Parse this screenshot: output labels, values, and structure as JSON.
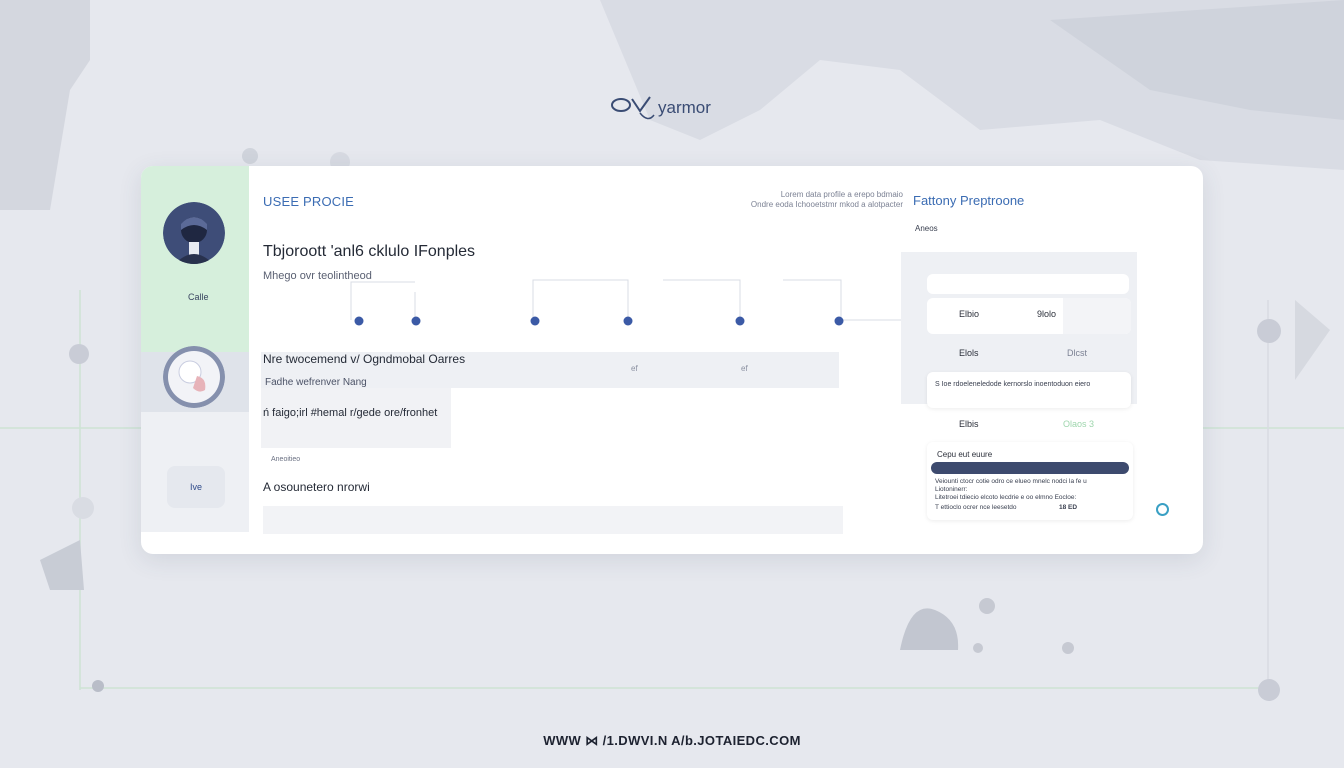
{
  "brand": {
    "logo_text": "yarmor"
  },
  "sidebar": {
    "items": [
      {
        "icon": "user-avatar-dark",
        "label": "Calle"
      },
      {
        "icon": "user-avatar-light",
        "label": ""
      },
      {
        "icon": "nav-tile",
        "label": "Ive"
      }
    ]
  },
  "main": {
    "section_title": "USEE PROCIE",
    "meta_lines": [
      "Lorem data profile  a   erepo bdmaio",
      "Ondre eoda Ichooetstmr mkod  a  alotpacter"
    ],
    "headline": "Tbjoroott 'anl6 cklulo IFonples",
    "subline": "Mhego ovr teolintheod",
    "timeline_points": 6,
    "row": {
      "title": "Nre twocemend v/ Ogndmobal Oarres",
      "subtitle": "Fadhe wefrenver Nang",
      "mini_a": "ef",
      "mini_b": "ef",
      "description": "ń faigo;irl #hemal   r/gede ore/fronhet"
    },
    "input": {
      "label": "Aneoitieo",
      "value": "A osounetero nrorwi"
    }
  },
  "right": {
    "title": "Fattony Preptroone",
    "subtitle": "Aneos",
    "kv_rows": [
      {
        "key": "Elbio",
        "value": "9lolo"
      },
      {
        "key": "Elols",
        "value": "Dlcst"
      },
      {
        "key": "Elbis",
        "value": "Olaos 3"
      }
    ],
    "note": "S  Ioe rdoeleneledode kernorslo inoentoduon eiero",
    "security": {
      "heading": "Cepu eut euure",
      "lines": [
        "Veiounti ctocr cotie odro ce elueo mnelc nodci la fe u",
        "Liotoninerr:",
        "Litetroei tdiecio elcoto lecdrie e oo elmno Eocloe:",
        "T ettioclo  ocrer nce   leesetdo"
      ],
      "trailing_value": "18 ED"
    }
  },
  "footer": {
    "url": "WWW ⋈ /1.DWVI.N  A/b.JOTAIEDC.COM"
  },
  "colors": {
    "accent": "#3b6cb3",
    "rail_green": "#d6efdc",
    "dark_bar": "#3d4a6e",
    "timeline_dot": "#3b5aa6"
  }
}
